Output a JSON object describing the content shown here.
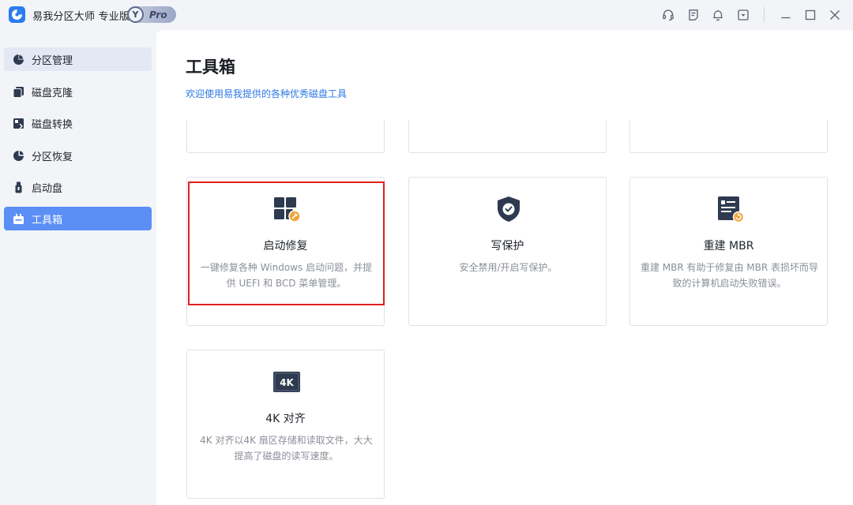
{
  "titlebar": {
    "app_title": "易我分区大师 专业版",
    "badge_letter": "Y",
    "badge_text": "Pro",
    "icons": [
      "headset-icon",
      "notes-icon",
      "bell-icon",
      "dropdown-menu-icon",
      "minimize-icon",
      "maximize-icon",
      "close-icon"
    ]
  },
  "sidebar": {
    "items": [
      {
        "label": "分区管理",
        "icon": "pie-chart-icon"
      },
      {
        "label": "磁盘克隆",
        "icon": "disk-clone-icon"
      },
      {
        "label": "磁盘转换",
        "icon": "disk-convert-icon"
      },
      {
        "label": "分区恢复",
        "icon": "partition-recover-icon"
      },
      {
        "label": "启动盘",
        "icon": "usb-drive-icon"
      },
      {
        "label": "工具箱",
        "icon": "toolbox-icon"
      }
    ],
    "active_index": 5
  },
  "main": {
    "title": "工具箱",
    "subtitle": "欢迎使用易我提供的各种优秀磁盘工具",
    "cards": [
      {
        "title": "启动修复",
        "desc": "一键修复各种 Windows 启动问题，并提供 UEFI 和 BCD 菜单管理。",
        "icon": "windows-repair-icon"
      },
      {
        "title": "写保护",
        "desc": "安全禁用/开启写保护。",
        "icon": "shield-check-icon"
      },
      {
        "title": "重建 MBR",
        "desc": "重建 MBR 有助于修复由 MBR 表损坏而导致的计算机启动失败错误。",
        "icon": "rebuild-mbr-icon"
      },
      {
        "title": "4K 对齐",
        "desc": "4K 对齐以4K 扇区存储和读取文件，大大提高了磁盘的读写速度。",
        "icon": "4k-align-icon",
        "icon_text": "4K"
      }
    ]
  },
  "colors": {
    "accent": "#5b8ff5",
    "link": "#2b78e4",
    "highlight_border": "#e02020",
    "icon_dark": "#2d3a4f",
    "icon_orange": "#f3a33a"
  }
}
